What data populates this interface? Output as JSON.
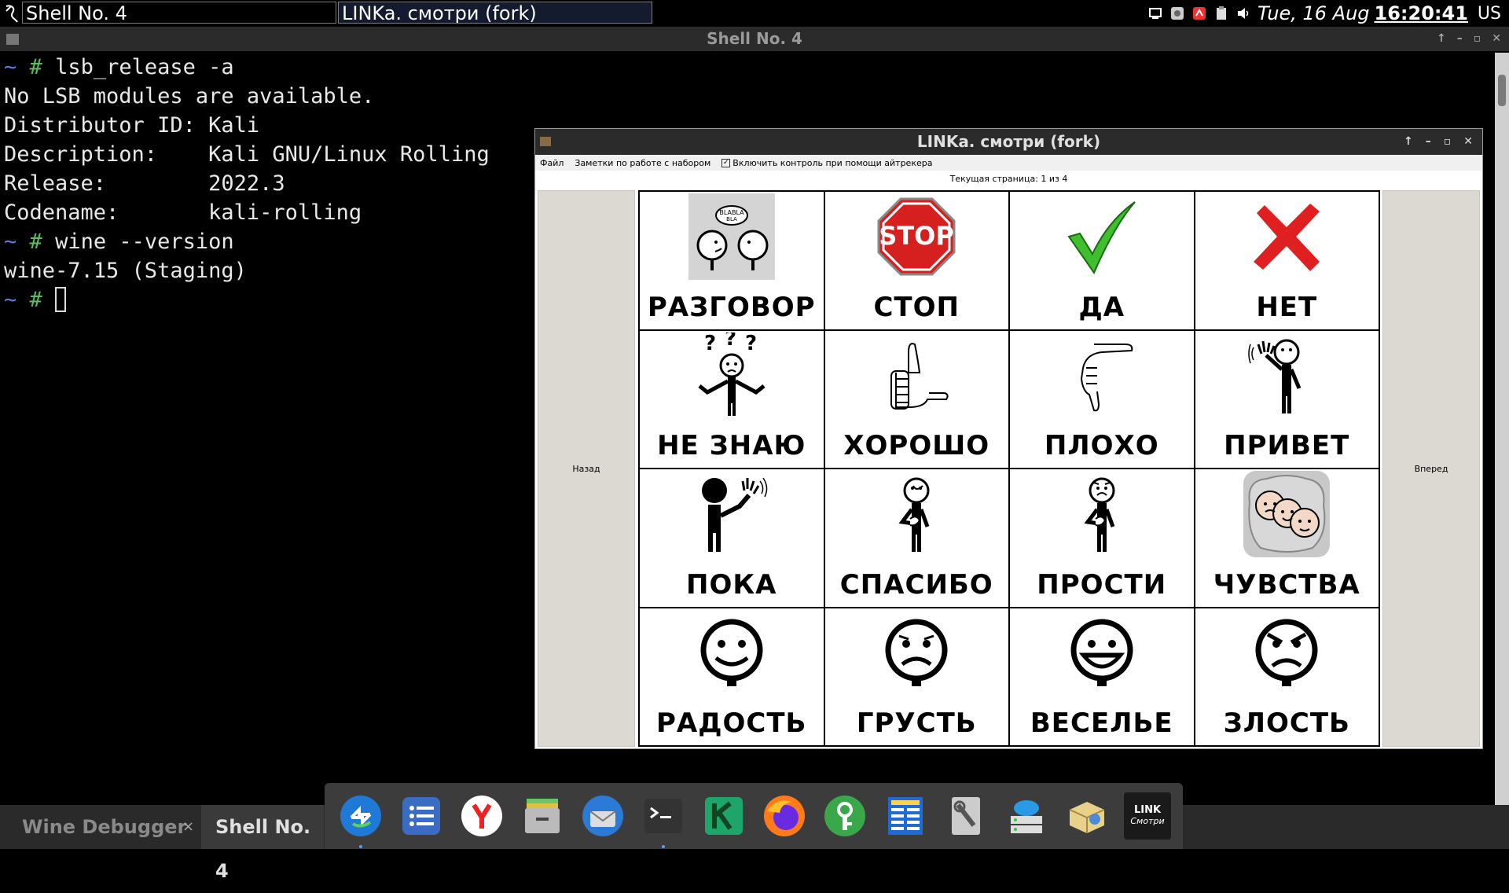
{
  "top_panel": {
    "tasks": [
      "Shell No. 4",
      "LINKa. смотри (fork)"
    ],
    "clock_date": "Tue, 16 Aug",
    "clock_time": "16:20:41",
    "keyboard_layout": "US"
  },
  "terminal": {
    "title": "Shell No. 4",
    "lines": [
      {
        "prompt": true,
        "text": "lsb_release -a"
      },
      {
        "prompt": false,
        "text": "No LSB modules are available."
      },
      {
        "prompt": false,
        "text": "Distributor ID: Kali"
      },
      {
        "prompt": false,
        "text": "Description:    Kali GNU/Linux Rolling"
      },
      {
        "prompt": false,
        "text": "Release:        2022.3"
      },
      {
        "prompt": false,
        "text": "Codename:       kali-rolling"
      },
      {
        "prompt": true,
        "text": "wine --version"
      },
      {
        "prompt": false,
        "text": "wine-7.15 (Staging)"
      }
    ],
    "prompt_tilde": "~",
    "prompt_hash": "#"
  },
  "linka": {
    "title": "LINKa. смотри (fork)",
    "menu": {
      "file": "Файл",
      "notes": "Заметки по работе с набором",
      "eyetracker": "Включить контроль при помощи айтрекера",
      "eyetracker_checked": true
    },
    "page_info": "Текущая страница: 1 из 4",
    "back_label": "Назад",
    "forward_label": "Вперед",
    "cards": [
      {
        "label": "РАЗГОВОР",
        "icon": "talk-icon"
      },
      {
        "label": "СТОП",
        "icon": "stop-sign-icon"
      },
      {
        "label": "ДА",
        "icon": "check-icon"
      },
      {
        "label": "НЕТ",
        "icon": "cross-icon"
      },
      {
        "label": "НЕ ЗНАЮ",
        "icon": "shrug-icon"
      },
      {
        "label": "ХОРОШО",
        "icon": "thumbs-up-icon"
      },
      {
        "label": "ПЛОХО",
        "icon": "thumbs-down-icon"
      },
      {
        "label": "ПРИВЕТ",
        "icon": "wave-hello-icon"
      },
      {
        "label": "ПОКА",
        "icon": "wave-bye-icon"
      },
      {
        "label": "СПАСИБО",
        "icon": "thanks-icon"
      },
      {
        "label": "ПРОСТИ",
        "icon": "sorry-icon"
      },
      {
        "label": "ЧУВСТВА",
        "icon": "feelings-icon"
      },
      {
        "label": "РАДОСТЬ",
        "icon": "happy-face-icon"
      },
      {
        "label": "ГРУСТЬ",
        "icon": "sad-face-icon"
      },
      {
        "label": "ВЕСЕЛЬЕ",
        "icon": "laughing-face-icon"
      },
      {
        "label": "ЗЛОСТЬ",
        "icon": "angry-face-icon"
      }
    ]
  },
  "bottom_bar": {
    "tabs": [
      "Wine Debugger",
      "Shell No. 4"
    ],
    "close_glyph": "×",
    "linka_dock_label_top": "LINK",
    "linka_dock_label_bottom": "Смотри"
  },
  "dock_apps": [
    "remmina-icon",
    "tasks-icon",
    "yandex-browser-icon",
    "file-manager-icon",
    "thunderbird-icon",
    "terminal-icon",
    "kde-connect-icon",
    "firefox-icon",
    "keepass-icon",
    "task-manager-icon",
    "settings-icon",
    "network-cloud-icon",
    "package-manager-icon",
    "linka-icon"
  ],
  "colors": {
    "accent_blue": "#5a7ddc",
    "prompt_green": "#5ac05a",
    "stop_red": "#d62020",
    "check_green": "#3fbf2f"
  }
}
